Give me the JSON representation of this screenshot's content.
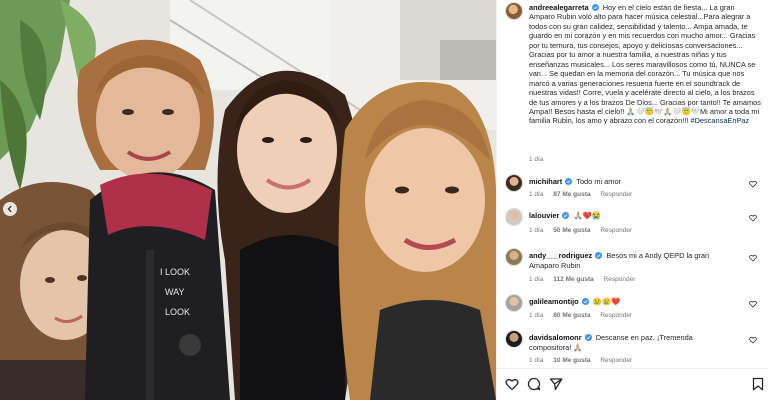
{
  "post": {
    "username": "andreealegarreta",
    "caption": "Hoy en el cielo están de fiesta... La gran Amparo Rubin voló alto para hacer música celestial...Para alegrar a todos con su gran calidez, sensibilidad y talento... Ampa amada, te guardo en mi corazón y en mis recuerdos con mucho amor... Gracias por tu ternura, tus consejos, apoyo y deliciosas conversaciones... Gracias por tu amor a nuestra familia, a nuestras niñas y tus enseñanzas musicales... Los seres maravillosos como tú, NUNCA se van... Se quedan en la memoria del corazón... Tu música que nos marcó a varias generaciones resuena fuerte en el soundtrack de nuestras vidas!! Corre, vuela y acelérate directo al cielo, a los brazos de tus amores y a los brazos De Dios... Gracias por tanto!! Te amamos Ampa!! Besos hasta el cielo!! 🙏🏼🤍😇🕊️🙏🏼🤍😇🕊️Mi amor a toda mi familia Rubin, los amo y abrazo con el corazón!!!",
    "hashtag": "#DescansaEnPaz",
    "time": "1 día"
  },
  "comments": [
    {
      "username": "michihart",
      "text": "Todo mi amor",
      "time": "1 día",
      "likes": "87 Me gusta",
      "reply": "Responder"
    },
    {
      "username": "lalouvier",
      "text": "🙏🏼❤️😭",
      "time": "1 día",
      "likes": "50 Me gusta",
      "reply": "Responder"
    },
    {
      "username": "andy___rodriguez",
      "text": "Besos mi a Andy QEPD la gran Amaparo Rubin",
      "time": "1 día",
      "likes": "112 Me gusta",
      "reply": "Responder"
    },
    {
      "username": "galileamontijo",
      "text": "😢😢❤️",
      "time": "1 día",
      "likes": "80 Me gusta",
      "reply": "Responder"
    },
    {
      "username": "davidsalomonr",
      "text": "Descanse en paz. ¡Tremenda compositora! 🙏🏼",
      "time": "1 día",
      "likes": "10 Me gusta",
      "reply": "Responder"
    }
  ],
  "colors": {
    "verified": "#3897f0",
    "meta": "#737373",
    "hashtag": "#00376b",
    "border": "#efefef"
  },
  "icons": [
    "chevron-left-icon",
    "verified-icon",
    "heart-icon",
    "comment-icon",
    "share-icon",
    "bookmark-icon"
  ]
}
